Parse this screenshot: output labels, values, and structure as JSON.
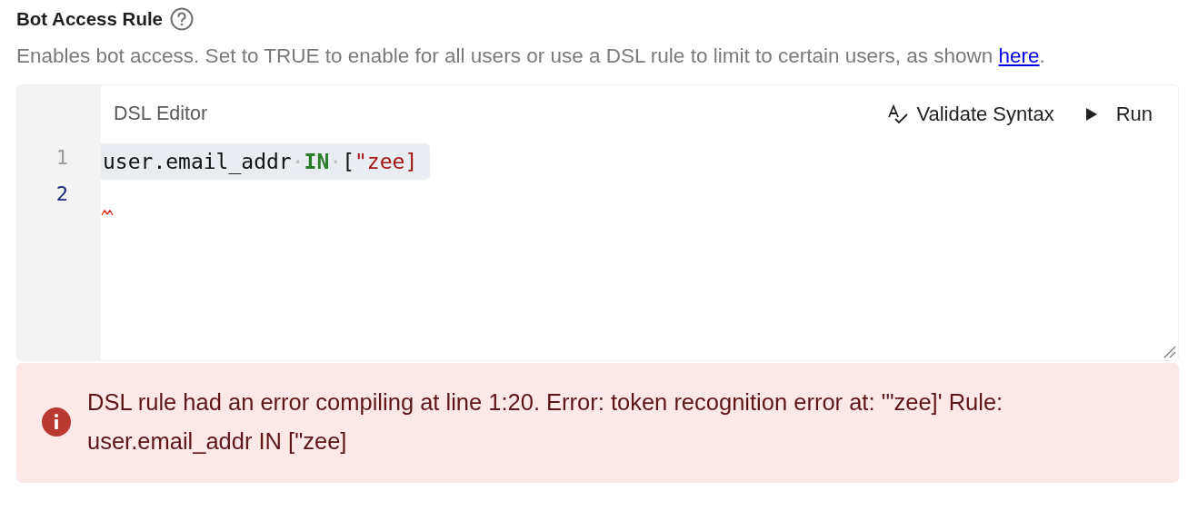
{
  "field": {
    "label": "Bot Access Rule",
    "description_before": "Enables bot access. Set to TRUE to enable for all users or use a DSL rule to limit to certain users, as shown",
    "link": "here",
    "description_after": "."
  },
  "editor": {
    "title": "DSL Editor",
    "actions": [
      {
        "kind": "validate",
        "label": "Validate Syntax"
      },
      {
        "kind": "run",
        "label": "Run"
      }
    ],
    "lines": [
      {
        "number": "1",
        "active": false,
        "selected": true,
        "error": false,
        "tokens": [
          {
            "kind": "plain",
            "text": "user.email_addr"
          },
          {
            "kind": "space",
            "text": "·"
          },
          {
            "kind": "keyword",
            "text": "IN"
          },
          {
            "kind": "space",
            "text": "·"
          },
          {
            "kind": "plain",
            "text": "["
          },
          {
            "kind": "string",
            "text": "\"zee]"
          }
        ]
      },
      {
        "number": "2",
        "active": true,
        "selected": false,
        "error": true
      }
    ]
  },
  "alert": {
    "kind": "error",
    "message": "DSL rule had an error compiling at line 1:20. Error: token recognition error at: '\"zee]' Rule: user.email_addr IN [\"zee]"
  }
}
